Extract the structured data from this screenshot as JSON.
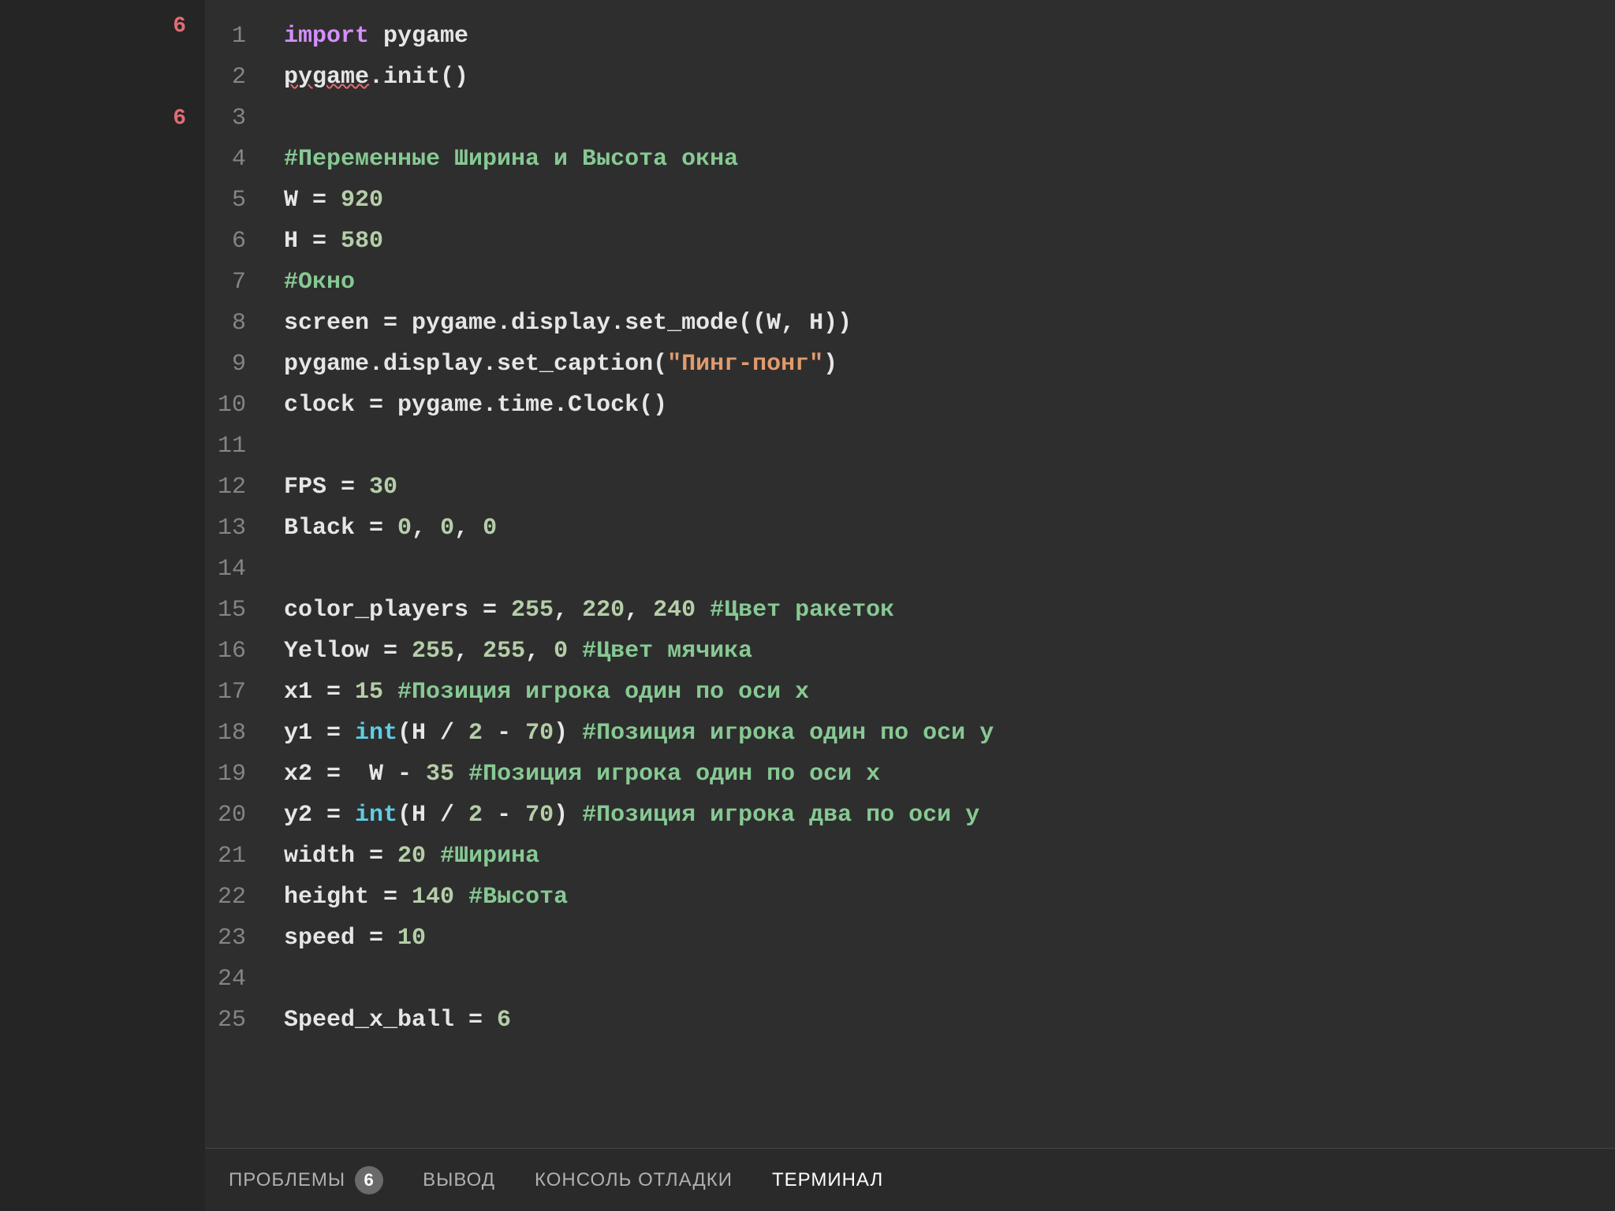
{
  "sidebar": {
    "badge1": "6",
    "badge2": "6"
  },
  "code": {
    "lines": [
      {
        "n": "1",
        "t": [
          [
            "kw",
            "import"
          ],
          [
            "def",
            " pygame"
          ]
        ]
      },
      {
        "n": "2",
        "t": [
          [
            "squiggle def",
            "pygame"
          ],
          [
            "def",
            ".init()"
          ]
        ]
      },
      {
        "n": "3",
        "t": [
          [
            "def",
            ""
          ]
        ]
      },
      {
        "n": "4",
        "t": [
          [
            "cmt",
            "#Переменные Ширина и Высота окна"
          ]
        ]
      },
      {
        "n": "5",
        "t": [
          [
            "def",
            "W = "
          ],
          [
            "num",
            "920"
          ]
        ]
      },
      {
        "n": "6",
        "t": [
          [
            "def",
            "H = "
          ],
          [
            "num",
            "580"
          ]
        ]
      },
      {
        "n": "7",
        "t": [
          [
            "cmt",
            "#Окно"
          ]
        ]
      },
      {
        "n": "8",
        "t": [
          [
            "def",
            "screen = pygame.display.set_mode((W, H))"
          ]
        ]
      },
      {
        "n": "9",
        "t": [
          [
            "def",
            "pygame.display.set_caption("
          ],
          [
            "str",
            "\"Пинг-понг\""
          ],
          [
            "def",
            ")"
          ]
        ]
      },
      {
        "n": "10",
        "t": [
          [
            "def",
            "clock = pygame.time.Clock()"
          ]
        ]
      },
      {
        "n": "11",
        "t": [
          [
            "def",
            ""
          ]
        ]
      },
      {
        "n": "12",
        "t": [
          [
            "def",
            "FPS = "
          ],
          [
            "num",
            "30"
          ]
        ]
      },
      {
        "n": "13",
        "t": [
          [
            "def",
            "Black = "
          ],
          [
            "num",
            "0"
          ],
          [
            "def",
            ", "
          ],
          [
            "num",
            "0"
          ],
          [
            "def",
            ", "
          ],
          [
            "num",
            "0"
          ]
        ]
      },
      {
        "n": "14",
        "t": [
          [
            "def",
            ""
          ]
        ]
      },
      {
        "n": "15",
        "t": [
          [
            "def",
            "color_players = "
          ],
          [
            "num",
            "255"
          ],
          [
            "def",
            ", "
          ],
          [
            "num",
            "220"
          ],
          [
            "def",
            ", "
          ],
          [
            "num",
            "240"
          ],
          [
            "def",
            " "
          ],
          [
            "cmt",
            "#Цвет ракеток"
          ]
        ]
      },
      {
        "n": "16",
        "t": [
          [
            "def",
            "Yellow = "
          ],
          [
            "num",
            "255"
          ],
          [
            "def",
            ", "
          ],
          [
            "num",
            "255"
          ],
          [
            "def",
            ", "
          ],
          [
            "num",
            "0"
          ],
          [
            "def",
            " "
          ],
          [
            "cmt",
            "#Цвет мячика"
          ]
        ]
      },
      {
        "n": "17",
        "t": [
          [
            "def",
            "x1 = "
          ],
          [
            "num",
            "15"
          ],
          [
            "def",
            " "
          ],
          [
            "cmt",
            "#Позиция игрока один по оси x"
          ]
        ]
      },
      {
        "n": "18",
        "t": [
          [
            "def",
            "y1 = "
          ],
          [
            "builtin",
            "int"
          ],
          [
            "def",
            "(H / "
          ],
          [
            "num",
            "2"
          ],
          [
            "def",
            " - "
          ],
          [
            "num",
            "70"
          ],
          [
            "def",
            ") "
          ],
          [
            "cmt",
            "#Позиция игрока один по оси y"
          ]
        ]
      },
      {
        "n": "19",
        "t": [
          [
            "def",
            "x2 =  W - "
          ],
          [
            "num",
            "35"
          ],
          [
            "def",
            " "
          ],
          [
            "cmt",
            "#Позиция игрока один по оси x"
          ]
        ]
      },
      {
        "n": "20",
        "t": [
          [
            "def",
            "y2 = "
          ],
          [
            "builtin",
            "int"
          ],
          [
            "def",
            "(H / "
          ],
          [
            "num",
            "2"
          ],
          [
            "def",
            " - "
          ],
          [
            "num",
            "70"
          ],
          [
            "def",
            ") "
          ],
          [
            "cmt",
            "#Позиция игрока два по оси y"
          ]
        ]
      },
      {
        "n": "21",
        "t": [
          [
            "def",
            "width = "
          ],
          [
            "num",
            "20"
          ],
          [
            "def",
            " "
          ],
          [
            "cmt",
            "#Ширина"
          ]
        ]
      },
      {
        "n": "22",
        "t": [
          [
            "def",
            "height = "
          ],
          [
            "num",
            "140"
          ],
          [
            "def",
            " "
          ],
          [
            "cmt",
            "#Высота"
          ]
        ]
      },
      {
        "n": "23",
        "t": [
          [
            "def",
            "speed = "
          ],
          [
            "num",
            "10"
          ]
        ]
      },
      {
        "n": "24",
        "t": [
          [
            "def",
            ""
          ]
        ]
      },
      {
        "n": "25",
        "t": [
          [
            "def",
            "Speed_x_ball = "
          ],
          [
            "num",
            "6"
          ]
        ]
      }
    ]
  },
  "panel": {
    "tabs": {
      "problems": "ПРОБЛЕМЫ",
      "problems_badge": "6",
      "output": "ВЫВОД",
      "debug": "КОНСОЛЬ ОТЛАДКИ",
      "terminal": "ТЕРМИНАЛ"
    }
  }
}
